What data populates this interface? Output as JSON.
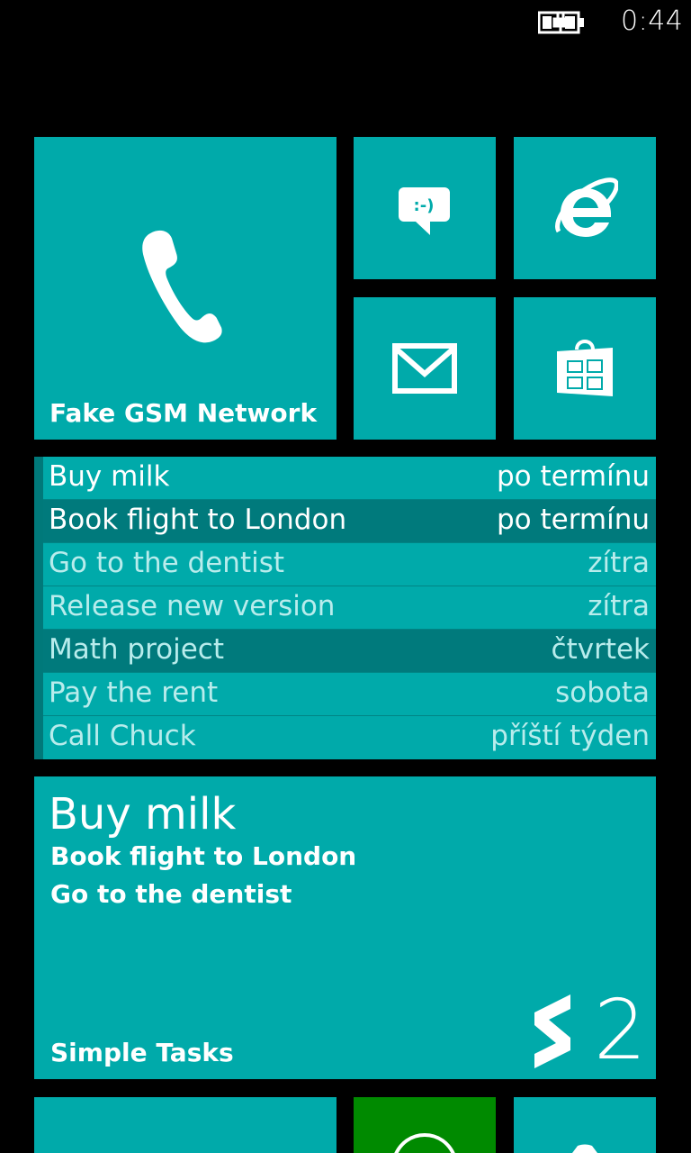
{
  "status": {
    "time": "0:44",
    "battery_icon": "battery-charging-icon"
  },
  "tiles": {
    "phone": {
      "label": "Fake GSM Network",
      "icon": "phone-icon"
    },
    "messaging": {
      "icon": "messaging-icon"
    },
    "browser": {
      "icon": "internet-explorer-icon"
    },
    "mail": {
      "icon": "mail-icon"
    },
    "store": {
      "icon": "store-icon"
    }
  },
  "tasks": [
    {
      "name": "Buy milk",
      "due": "po termínu"
    },
    {
      "name": "Book flight to London",
      "due": "po termínu"
    },
    {
      "name": "Go to the dentist",
      "due": "zítra"
    },
    {
      "name": "Release new version",
      "due": "zítra"
    },
    {
      "name": "Math project",
      "due": "čtvrtek"
    },
    {
      "name": "Pay the rent",
      "due": "sobota"
    },
    {
      "name": "Call Chuck",
      "due": "příští týden"
    }
  ],
  "simple_tasks_tile": {
    "title": "Buy milk",
    "line2": "Book flight to London",
    "line3": "Go to the dentist",
    "label": "Simple Tasks",
    "count": "2",
    "icon": "simple-tasks-logo-icon"
  },
  "colors": {
    "accent": "#00AAAA",
    "accent_dark": "#007A7C",
    "green": "#008A00",
    "background": "#000000"
  }
}
